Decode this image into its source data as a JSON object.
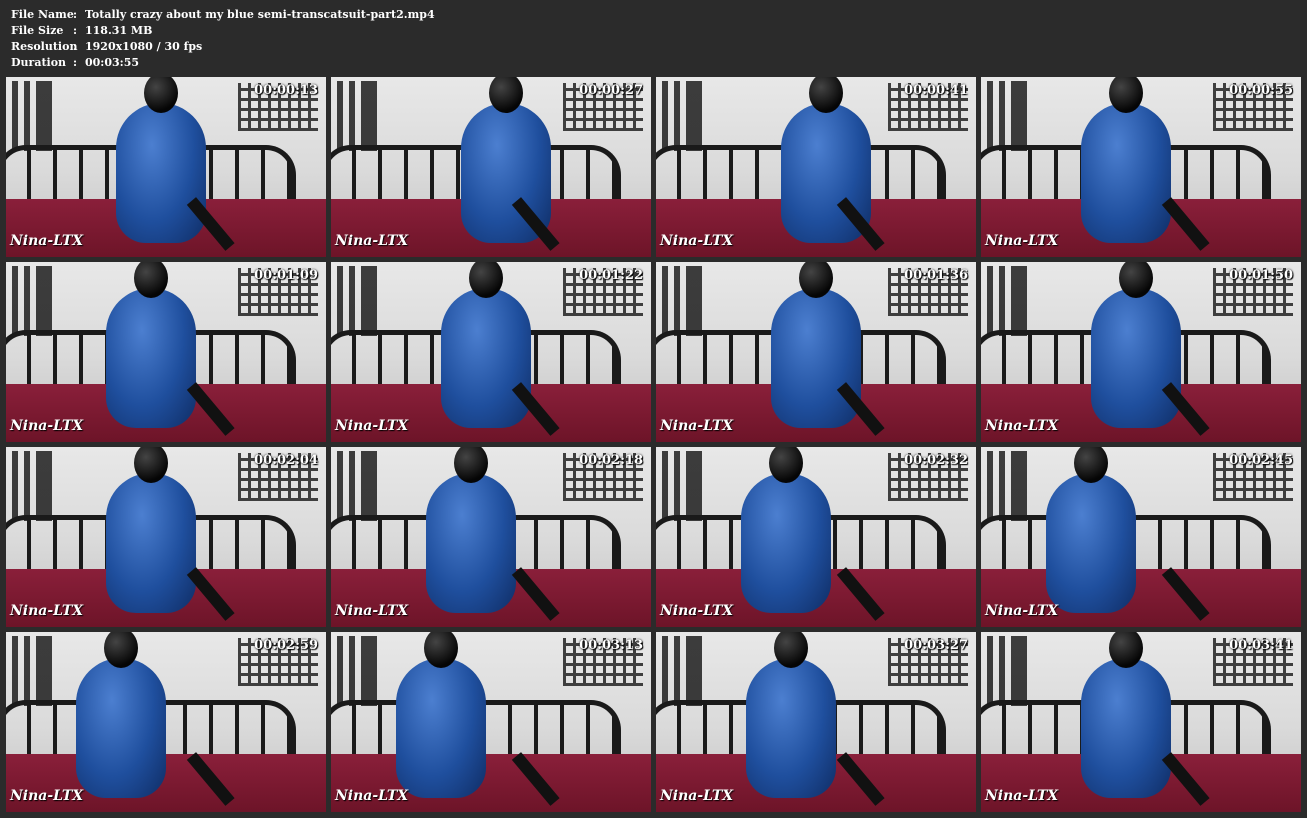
{
  "info": {
    "file_name_label": "File Name",
    "file_name": "Totally crazy about my blue semi-transcatsuit-part2.mp4",
    "file_size_label": "File Size",
    "file_size": "118.31 MB",
    "resolution_label": "Resolution",
    "resolution": "1920x1080 / 30 fps",
    "duration_label": "Duration",
    "duration": "00:03:55",
    "separator": ":"
  },
  "watermark": "Nina-LTX",
  "thumbnails": [
    {
      "time": "00:00:13"
    },
    {
      "time": "00:00:27"
    },
    {
      "time": "00:00:41"
    },
    {
      "time": "00:00:55"
    },
    {
      "time": "00:01:09"
    },
    {
      "time": "00:01:22"
    },
    {
      "time": "00:01:36"
    },
    {
      "time": "00:01:50"
    },
    {
      "time": "00:02:04"
    },
    {
      "time": "00:02:18"
    },
    {
      "time": "00:02:32"
    },
    {
      "time": "00:02:45"
    },
    {
      "time": "00:02:59"
    },
    {
      "time": "00:03:13"
    },
    {
      "time": "00:03:27"
    },
    {
      "time": "00:03:41"
    }
  ]
}
